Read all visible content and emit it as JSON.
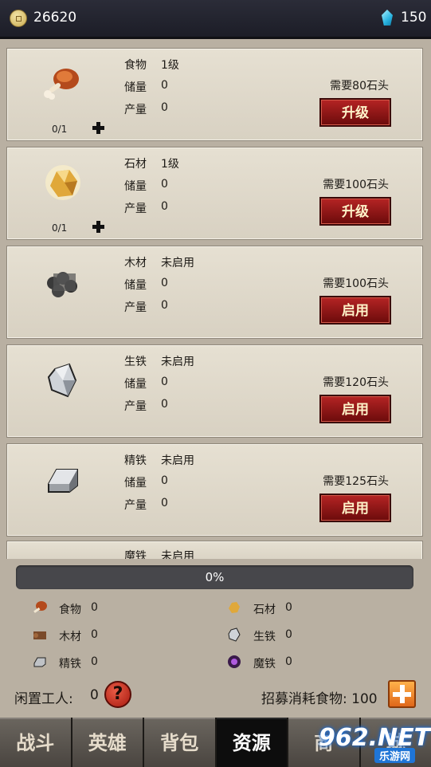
{
  "topbar": {
    "coins": "26620",
    "gems": "150",
    "coin_icon": "coin-icon",
    "gem_icon": "gem-icon"
  },
  "resources": [
    {
      "name": "食物",
      "status": "1级",
      "stock_label": "储量",
      "stock": "0",
      "prod_label": "产量",
      "prod": "0",
      "need": "需要80石头",
      "button": "升级",
      "ratio": "0/1",
      "icon": "meat-icon"
    },
    {
      "name": "石材",
      "status": "1级",
      "stock_label": "储量",
      "stock": "0",
      "prod_label": "产量",
      "prod": "0",
      "need": "需要100石头",
      "button": "升级",
      "ratio": "0/1",
      "icon": "stone-icon"
    },
    {
      "name": "木材",
      "status": "未启用",
      "stock_label": "储量",
      "stock": "0",
      "prod_label": "产量",
      "prod": "0",
      "need": "需要100石头",
      "button": "启用",
      "icon": "wood-icon"
    },
    {
      "name": "生铁",
      "status": "未启用",
      "stock_label": "储量",
      "stock": "0",
      "prod_label": "产量",
      "prod": "0",
      "need": "需要120石头",
      "button": "启用",
      "icon": "crystal-icon"
    },
    {
      "name": "精铁",
      "status": "未启用",
      "stock_label": "储量",
      "stock": "0",
      "prod_label": "产量",
      "prod": "0",
      "need": "需要125石头",
      "button": "启用",
      "icon": "ingot-icon"
    },
    {
      "name": "魔铁",
      "status": "未启用",
      "icon": "magic-iron-icon"
    }
  ],
  "progress": {
    "label": "0%",
    "value": 0
  },
  "stockpile": [
    {
      "name": "食物",
      "count": "0",
      "icon": "meat-icon"
    },
    {
      "name": "石材",
      "count": "0",
      "icon": "stone-icon"
    },
    {
      "name": "木材",
      "count": "0",
      "icon": "wood-icon"
    },
    {
      "name": "生铁",
      "count": "0",
      "icon": "crystal-icon"
    },
    {
      "name": "精铁",
      "count": "0",
      "icon": "ingot-icon"
    },
    {
      "name": "魔铁",
      "count": "0",
      "icon": "magic-iron-icon"
    }
  ],
  "workers": {
    "idle_label": "闲置工人:",
    "idle_count": "0",
    "help": "?",
    "recruit_label": "招募消耗食物:",
    "recruit_cost": "100"
  },
  "tabs": [
    "战斗",
    "英雄",
    "背包",
    "资源",
    "商",
    "城"
  ],
  "active_tab": "资源",
  "watermark": {
    "text": "962.NET",
    "sub": "乐游网"
  }
}
